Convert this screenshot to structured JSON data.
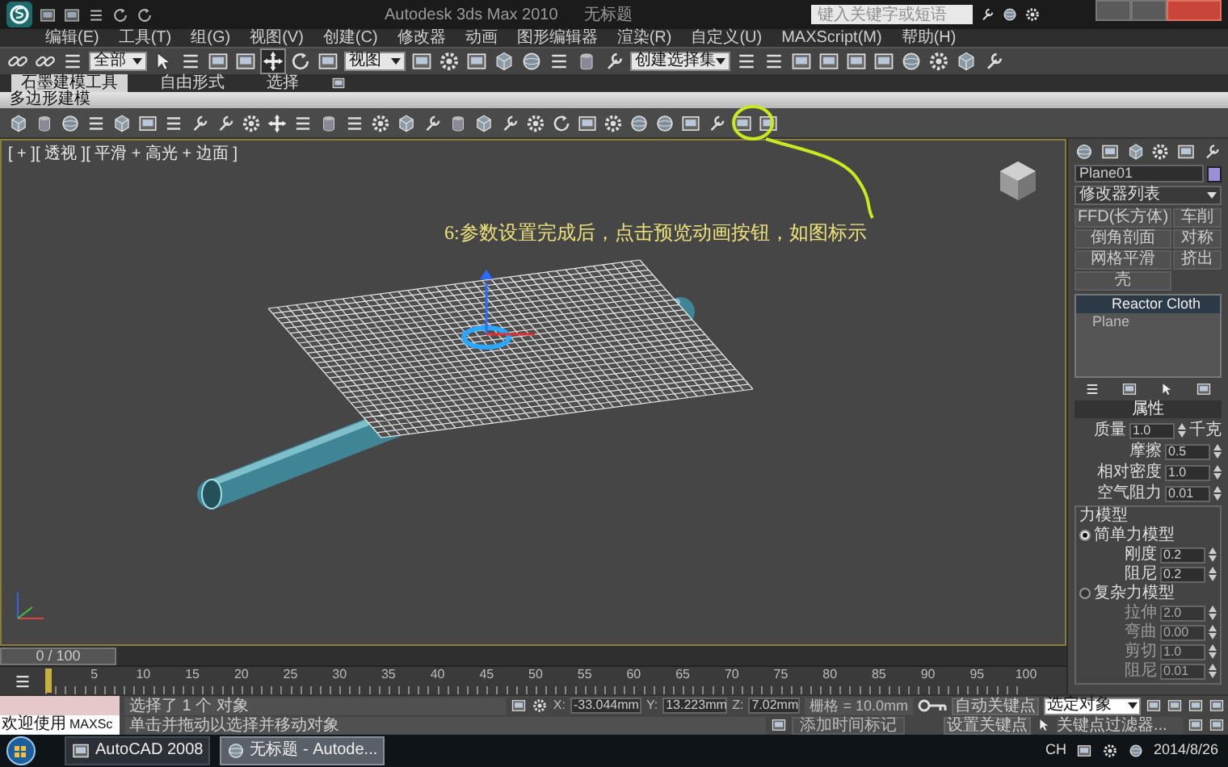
{
  "title_bar": {
    "title": "Autodesk 3ds Max 2010",
    "document": "无标题",
    "search": {
      "placeholder": "键入关键字或短语"
    }
  },
  "menu": [
    "编辑(E)",
    "工具(T)",
    "组(G)",
    "视图(V)",
    "创建(C)",
    "修改器",
    "动画",
    "图形编辑器",
    "渲染(R)",
    "自定义(U)",
    "MAXScript(M)",
    "帮助(H)"
  ],
  "main_toolbar": {
    "selection_filter": "全部",
    "reference_coord": "视图",
    "named_selection": "创建选择集"
  },
  "ribbon": {
    "tabs": [
      {
        "label": "石墨建模工具",
        "selected": true
      },
      {
        "label": "自由形式",
        "selected": false
      },
      {
        "label": "选择",
        "selected": false
      }
    ],
    "panel_label": "多边形建模"
  },
  "viewport": {
    "label": "[ + ][ 透视 ][ 平滑 + 高光 + 边面 ]",
    "annotation": "6:参数设置完成后，点击预览动画按钮，如图标示"
  },
  "command_panel": {
    "object_name": "Plane01",
    "modifier_list": "修改器列表",
    "modifier_buttons": [
      "FFD(长方体)",
      "车削",
      "倒角剖面",
      "对称",
      "网格平滑",
      "挤出",
      "壳"
    ],
    "stack": [
      {
        "label": "Reactor Cloth",
        "selected": true
      },
      {
        "label": "Plane",
        "selected": false
      }
    ],
    "rollout_title": "属性",
    "mass": {
      "label": "质量",
      "value": "1.0",
      "unit": "千克"
    },
    "properties": [
      {
        "label": "摩擦",
        "value": "0.5"
      },
      {
        "label": "相对密度",
        "value": "1.0"
      },
      {
        "label": "空气阻力",
        "value": "0.01"
      }
    ],
    "force_model_title": "力模型",
    "force_models": [
      {
        "label": "简单力模型",
        "selected": true,
        "params": [
          {
            "label": "刚度",
            "value": "0.2"
          },
          {
            "label": "阻尼",
            "value": "0.2"
          }
        ]
      },
      {
        "label": "复杂力模型",
        "selected": false,
        "params": [
          {
            "label": "拉伸",
            "value": "2.0"
          },
          {
            "label": "弯曲",
            "value": "0.00"
          },
          {
            "label": "剪切",
            "value": "1.0"
          },
          {
            "label": "阻尼",
            "value": "0.01"
          }
        ]
      }
    ]
  },
  "time_slider": {
    "position": "0 / 100",
    "level": 0
  },
  "track_bar": {
    "ticks": [
      "5",
      "10",
      "15",
      "20",
      "25",
      "30",
      "35",
      "40",
      "45",
      "50",
      "55",
      "60",
      "65",
      "70",
      "75",
      "80",
      "85",
      "90",
      "95",
      "100"
    ]
  },
  "status": {
    "script_listener": "欢迎使用",
    "script_listener_tag": "MAXSc",
    "selection": "选择了 1 个 对象",
    "prompt": "单击并拖动以选择并移动对象",
    "x_label": "X:",
    "x": "-33.044mm",
    "y_label": "Y:",
    "y": "13.223mm",
    "z_label": "Z:",
    "z": "7.02mm",
    "grid": "栅格 = 10.0mm",
    "add_time_tag": "添加时间标记",
    "auto_key": "自动关键点",
    "key_mode": "选定对象",
    "set_key": "设置关键点",
    "key_filters": "关键点过滤器..."
  },
  "taskbar": {
    "items": [
      {
        "label": "AutoCAD 2008",
        "selected": false
      },
      {
        "label": "无标题 - Autode...",
        "selected": true
      }
    ],
    "language": "CH",
    "date": "2014/8/26"
  }
}
